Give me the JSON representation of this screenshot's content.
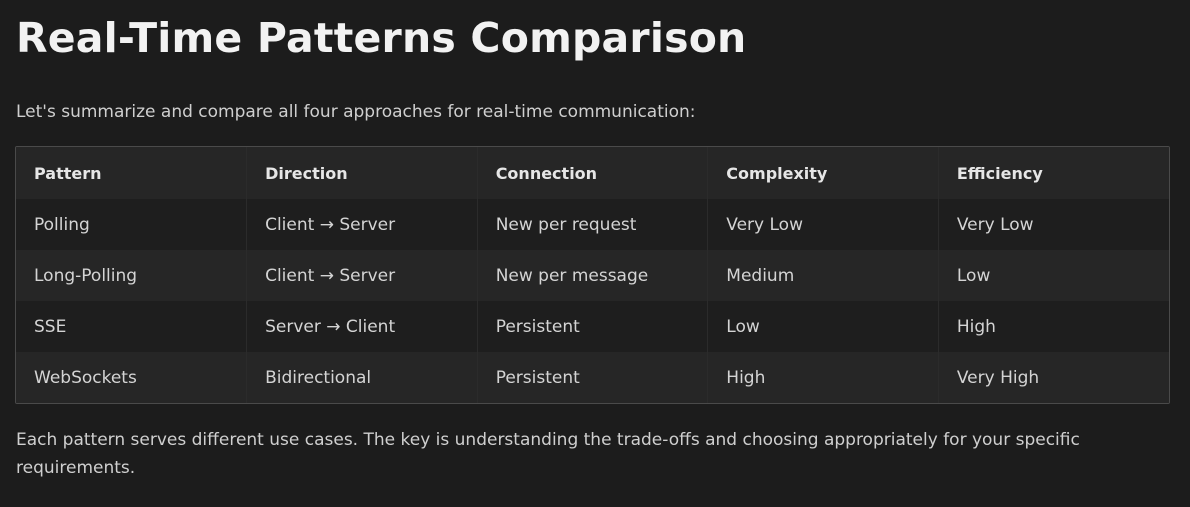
{
  "title": "Real-Time Patterns Comparison",
  "intro": "Let's summarize and compare all four approaches for real-time communication:",
  "table": {
    "headers": [
      "Pattern",
      "Direction",
      "Connection",
      "Complexity",
      "Efficiency"
    ],
    "rows": [
      [
        "Polling",
        "Client → Server",
        "New per request",
        "Very Low",
        "Very Low"
      ],
      [
        "Long-Polling",
        "Client → Server",
        "New per message",
        "Medium",
        "Low"
      ],
      [
        "SSE",
        "Server → Client",
        "Persistent",
        "Low",
        "High"
      ],
      [
        "WebSockets",
        "Bidirectional",
        "Persistent",
        "High",
        "Very High"
      ]
    ]
  },
  "outro": "Each pattern serves different use cases. The key is understanding the trade-offs and choosing appropriately for your specific requirements.",
  "colors": {
    "background": "#1c1c1c",
    "header_row": "#262626",
    "row_alt": "#262626",
    "border": "#4a4a4a"
  }
}
